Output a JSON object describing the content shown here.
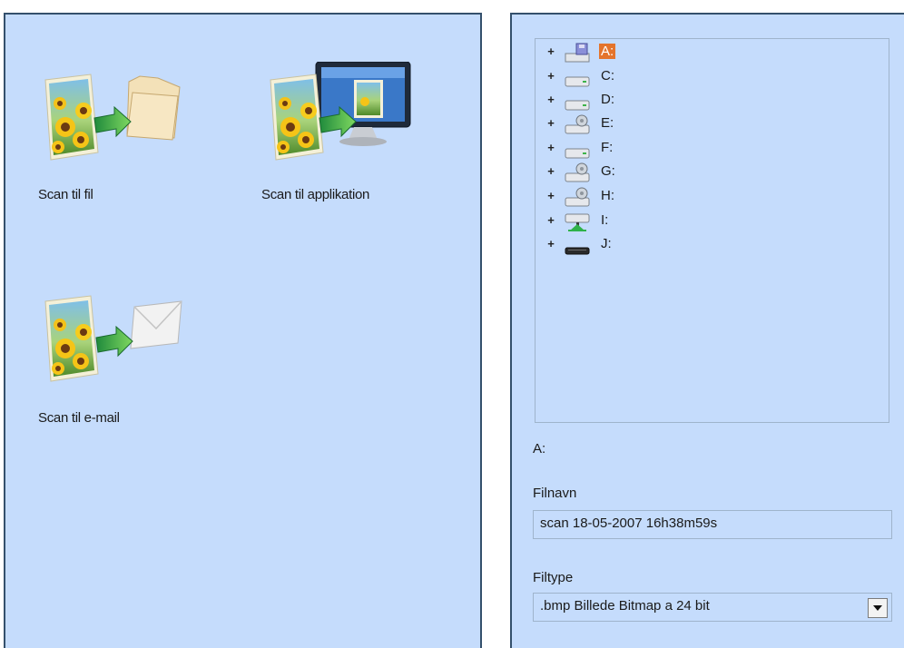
{
  "actions": [
    {
      "label": "Scan til fil",
      "icon": "scan-to-file-icon"
    },
    {
      "label": "Scan til applikation",
      "icon": "scan-to-application-icon"
    },
    {
      "label": "Scan til e-mail",
      "icon": "scan-to-email-icon"
    }
  ],
  "tree": {
    "drives": [
      {
        "label": "A:",
        "icon": "floppy-drive-icon",
        "selected": true
      },
      {
        "label": "C:",
        "icon": "hard-drive-icon"
      },
      {
        "label": "D:",
        "icon": "hard-drive-icon"
      },
      {
        "label": "E:",
        "icon": "removable-drive-icon"
      },
      {
        "label": "F:",
        "icon": "hard-drive-icon"
      },
      {
        "label": "G:",
        "icon": "removable-drive-icon"
      },
      {
        "label": "H:",
        "icon": "removable-drive-icon"
      },
      {
        "label": "I:",
        "icon": "network-drive-icon"
      },
      {
        "label": "J:",
        "icon": "optical-drive-icon"
      }
    ],
    "expand_glyph": "+"
  },
  "selected_path": "A:",
  "filename": {
    "label": "Filnavn",
    "value": "scan 18-05-2007 16h38m59s"
  },
  "filetype": {
    "label": "Filtype",
    "value": ".bmp Billede Bitmap a 24 bit"
  },
  "colors": {
    "panel_bg": "#c5dcfc",
    "panel_border": "#34506c",
    "selection": "#e4742c"
  }
}
